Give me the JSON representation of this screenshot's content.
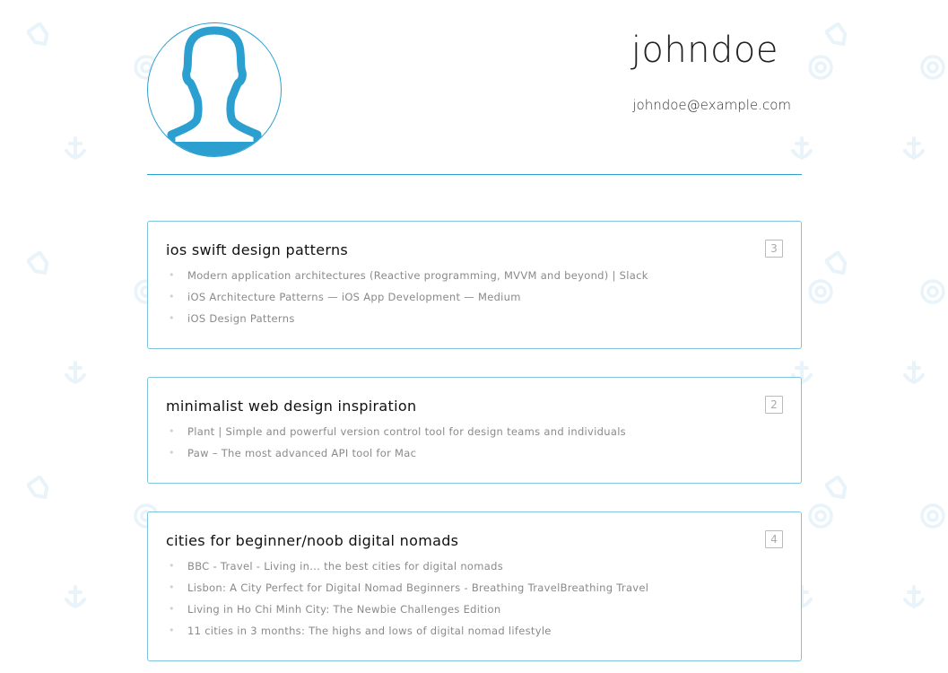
{
  "profile": {
    "username": "johndoe",
    "email": "johndoe@example.com",
    "avatar_icon": "user-silhouette-icon"
  },
  "colors": {
    "accent": "#2b9fd0",
    "card_border": "#7fc3df",
    "link_text": "#8a8a8a",
    "background_pattern": "#e8f3fa"
  },
  "collections": [
    {
      "title": "ios swift design patterns",
      "count": "3",
      "links": [
        "Modern application architectures (Reactive programming, MVVM and beyond) | Slack",
        "iOS Architecture Patterns — iOS App Development — Medium",
        "iOS Design Patterns"
      ]
    },
    {
      "title": "minimalist web design inspiration",
      "count": "2",
      "links": [
        "Plant | Simple and powerful version control tool for design teams and individuals",
        "Paw – The most advanced API tool for Mac"
      ]
    },
    {
      "title": "cities for beginner/noob digital nomads",
      "count": "4",
      "links": [
        "BBC - Travel - Living in... the best cities for digital nomads",
        "Lisbon: A City Perfect for Digital Nomad Beginners - Breathing TravelBreathing Travel",
        "Living in Ho Chi Minh City: The Newbie Challenges Edition",
        "11 cities in 3 months: The highs and lows of digital nomad lifestyle"
      ]
    }
  ]
}
